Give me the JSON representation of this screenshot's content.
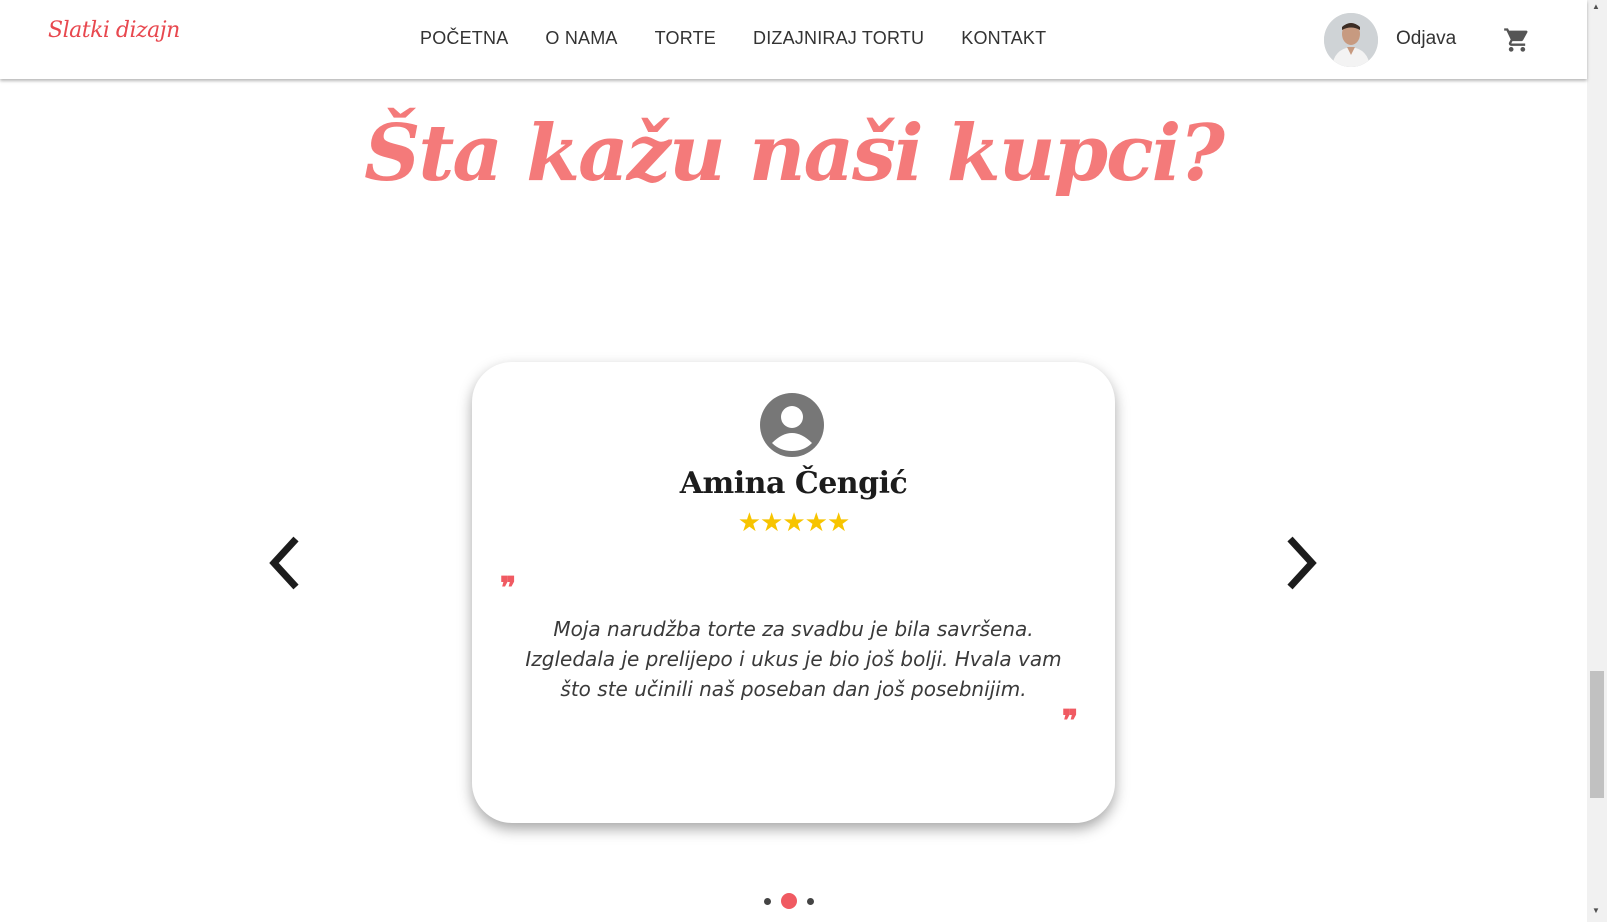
{
  "nav": {
    "logo": "Slatki dizajn",
    "links": [
      "POČETNA",
      "O NAMA",
      "TORTE",
      "DIZAJNIRAJ TORTU",
      "KONTAKT"
    ],
    "logout_label": "Odjava"
  },
  "section": {
    "title": "Šta kažu naši kupci?"
  },
  "testimonial": {
    "name": "Amina Čengić",
    "stars": "★★★★★",
    "rating": 5,
    "quote_open": "❞",
    "quote_close": "❞",
    "text": "Moja narudžba torte za svadbu je bila savršena. Izgledala je prelijepo i ukus je bio još bolji. Hvala vam što ste učinili naš poseban dan još posebnijim."
  },
  "carousel": {
    "slide_count": 3,
    "active_index": 1
  },
  "colors": {
    "accent": "#f05a62",
    "title": "#f47a7a",
    "star": "#f7c400"
  },
  "icons": [
    "cart-icon",
    "user-circle-icon",
    "chevron-left-icon",
    "chevron-right-icon"
  ]
}
